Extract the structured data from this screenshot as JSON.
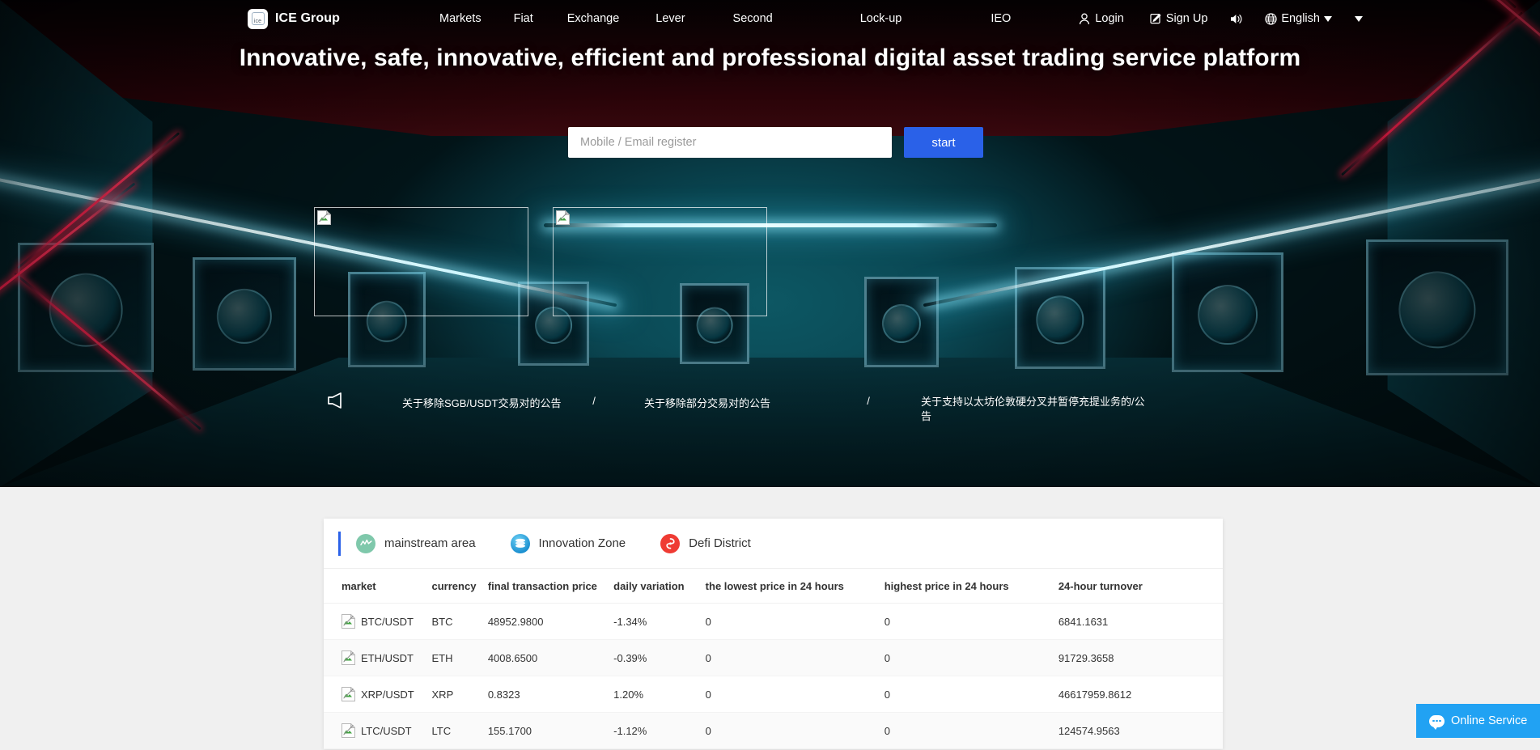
{
  "nav": {
    "logo_text": "ICE Group",
    "logo_mark_text": "ice",
    "menu": [
      {
        "label": "Markets"
      },
      {
        "label": "Fiat"
      },
      {
        "label": "Exchange"
      },
      {
        "label": "Lever"
      },
      {
        "label": "Second"
      },
      {
        "label": "Lock-up"
      },
      {
        "label": "IEO"
      }
    ],
    "login": "Login",
    "signup": "Sign Up",
    "language": "English",
    "icons": {
      "user": "user-icon",
      "pencil": "pencil-icon",
      "sound": "sound-icon",
      "globe": "globe-icon",
      "caret": "chevron-down-icon"
    }
  },
  "hero": {
    "headline": "Innovative, safe, innovative, efficient and professional digital asset trading service platform",
    "register_placeholder": "Mobile / Email register",
    "register_value": "",
    "start_label": "start",
    "banners": [
      {
        "alt": "banner-image-1"
      },
      {
        "alt": "banner-image-2"
      }
    ],
    "announcements": [
      {
        "text": "关于移除SGB/USDT交易对的公告"
      },
      {
        "text": "关于移除部分交易对的公告"
      },
      {
        "text": "关于支持以太坊伦敦硬分叉并暂停充提业务的/公告"
      }
    ],
    "separator": "/"
  },
  "market": {
    "tabs": [
      {
        "label": "mainstream area",
        "icon": "chart-wave-icon",
        "active": true
      },
      {
        "label": "Innovation Zone",
        "icon": "coins-stack-icon",
        "active": false
      },
      {
        "label": "Defi District",
        "icon": "defi-icon",
        "active": false
      }
    ],
    "columns": [
      "market",
      "currency",
      "final transaction price",
      "daily variation",
      "the lowest price in 24 hours",
      "highest price in 24 hours",
      "24-hour turnover"
    ],
    "rows": [
      {
        "market": "BTC/USDT",
        "currency": "BTC",
        "last": "48952.9800",
        "change": "-1.34%",
        "low24": "0",
        "high24": "0",
        "turnover": "6841.1631"
      },
      {
        "market": "ETH/USDT",
        "currency": "ETH",
        "last": "4008.6500",
        "change": "-0.39%",
        "low24": "0",
        "high24": "0",
        "turnover": "91729.3658"
      },
      {
        "market": "XRP/USDT",
        "currency": "XRP",
        "last": "0.8323",
        "change": "1.20%",
        "low24": "0",
        "high24": "0",
        "turnover": "46617959.8612"
      },
      {
        "market": "LTC/USDT",
        "currency": "LTC",
        "last": "155.1700",
        "change": "-1.12%",
        "low24": "0",
        "high24": "0",
        "turnover": "124574.9563"
      }
    ]
  },
  "chat": {
    "label": "Online Service",
    "icon": "chat-bubble-icon"
  },
  "colors": {
    "accent_blue": "#2a61e8",
    "chat_blue": "#21a2f3",
    "page_bg": "#f0f0f0",
    "neon_cyan": "#cdf6ff",
    "laser_red": "#ff1f4d"
  }
}
